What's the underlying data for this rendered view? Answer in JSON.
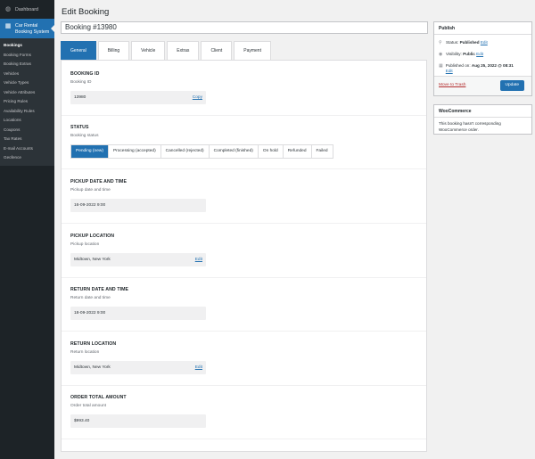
{
  "menu": {
    "dashboard": "Dashboard",
    "plugin": "Car Rental Booking System",
    "items": [
      "Bookings",
      "Booking Forms",
      "Booking Extras",
      "Vehicles",
      "Vehicle Types",
      "Vehicle Attributes",
      "Pricing Rules",
      "Availability Rules",
      "Locations",
      "Coupons",
      "Tax Rates",
      "E-mail Accounts",
      "Geofence"
    ]
  },
  "page_title": "Edit Booking",
  "booking_title": "Booking #13980",
  "tabs": [
    "General",
    "Billing",
    "Vehicle",
    "Extras",
    "Client",
    "Payment"
  ],
  "fields": {
    "booking_id": {
      "title": "BOOKING ID",
      "desc": "Booking ID",
      "value": "13980",
      "link": "Copy"
    },
    "status": {
      "title": "STATUS",
      "desc": "Booking status",
      "options": [
        "Pending (new)",
        "Processing (accepted)",
        "Cancelled (rejected)",
        "Completed (finished)",
        "On hold",
        "Refunded",
        "Failed"
      ],
      "selected": "Pending (new)"
    },
    "pickup_date": {
      "title": "PICKUP DATE AND TIME",
      "desc": "Pickup date and time",
      "value": "16-09-2022 9:00"
    },
    "pickup_location": {
      "title": "PICKUP LOCATION",
      "desc": "Pickup location",
      "value": "Midtown, New York",
      "link": "Edit"
    },
    "return_date": {
      "title": "RETURN DATE AND TIME",
      "desc": "Return date and time",
      "value": "18-09-2022 9:00"
    },
    "return_location": {
      "title": "RETURN LOCATION",
      "desc": "Return location",
      "value": "Midtown, New York",
      "link": "Edit"
    },
    "order_total": {
      "title": "ORDER TOTAL AMOUNT",
      "desc": "Order total amount",
      "value": "$993.40"
    }
  },
  "publish": {
    "title": "Publish",
    "status_label": "Status:",
    "status_value": "Published",
    "status_edit": "Edit",
    "visibility_label": "Visibility:",
    "visibility_value": "Public",
    "visibility_edit": "Edit",
    "published_label": "Published on:",
    "published_value": "Aug 25, 2022 @ 08:31",
    "published_edit": "Edit",
    "trash": "Move to Trash",
    "update": "Update"
  },
  "woocommerce": {
    "title": "WooCommerce",
    "text": "This booking hasn't corresponding WooCommerce order."
  },
  "colors": {
    "accent": "#2271b1",
    "menu_bg": "#1d2327",
    "trash": "#b32d2e"
  }
}
